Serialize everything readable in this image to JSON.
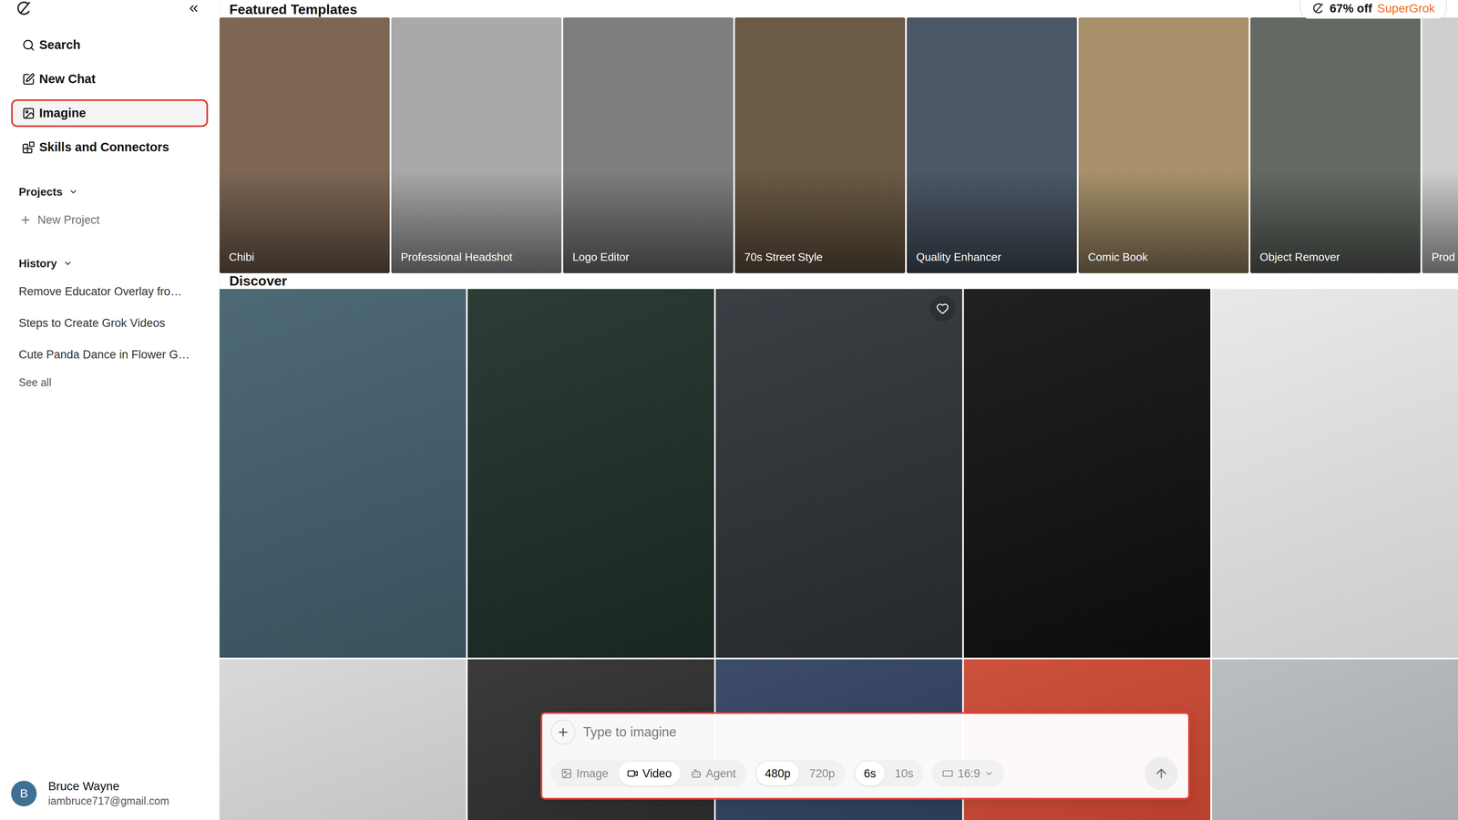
{
  "sidebar": {
    "nav": [
      {
        "label": "Search",
        "selected": false
      },
      {
        "label": "New Chat",
        "selected": false
      },
      {
        "label": "Imagine",
        "selected": true
      },
      {
        "label": "Skills and Connectors",
        "selected": false
      }
    ],
    "projects": {
      "title": "Projects",
      "new_label": "New Project"
    },
    "history": {
      "title": "History",
      "items": [
        "Remove Educator Overlay fro…",
        "Steps to Create Grok Videos",
        "Cute Panda Dance in Flower G…"
      ],
      "see_all": "See all"
    },
    "user": {
      "initial": "B",
      "name": "Bruce Wayne",
      "email": "iambruce717@gmail.com"
    }
  },
  "promo": {
    "discount": "67% off",
    "plan": "SuperGrok"
  },
  "featured": {
    "title": "Featured Templates",
    "templates": [
      {
        "label": "Chibi"
      },
      {
        "label": "Professional Headshot"
      },
      {
        "label": "Logo Editor"
      },
      {
        "label": "70s Street Style"
      },
      {
        "label": "Quality Enhancer"
      },
      {
        "label": "Comic Book"
      },
      {
        "label": "Object Remover"
      },
      {
        "label": "Prod"
      }
    ]
  },
  "discover": {
    "title": "Discover",
    "tiles": [
      {
        "hovered": false
      },
      {
        "hovered": false
      },
      {
        "hovered": true
      },
      {
        "hovered": false
      },
      {
        "hovered": false
      },
      {
        "hovered": false
      },
      {
        "hovered": false
      },
      {
        "hovered": false
      },
      {
        "hovered": false
      },
      {
        "hovered": false
      }
    ]
  },
  "prompt": {
    "placeholder": "Type to imagine",
    "modes": [
      {
        "label": "Image",
        "selected": false
      },
      {
        "label": "Video",
        "selected": true
      },
      {
        "label": "Agent",
        "selected": false
      }
    ],
    "resolutions": [
      {
        "label": "480p",
        "selected": true
      },
      {
        "label": "720p",
        "selected": false
      }
    ],
    "durations": [
      {
        "label": "6s",
        "selected": true
      },
      {
        "label": "10s",
        "selected": false
      }
    ],
    "aspect_ratio": "16:9"
  }
}
